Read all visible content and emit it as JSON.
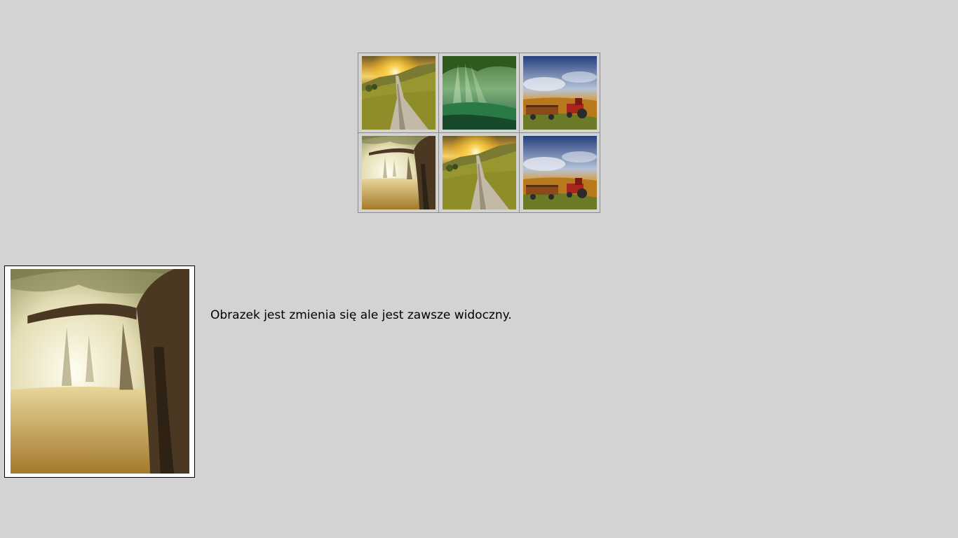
{
  "gallery": {
    "thumbnails": [
      {
        "icon": "sunset-road-icon"
      },
      {
        "icon": "forest-light-icon"
      },
      {
        "icon": "tractor-field-icon"
      },
      {
        "icon": "olive-grove-icon"
      },
      {
        "icon": "sunset-road-icon"
      },
      {
        "icon": "tractor-field-icon"
      }
    ]
  },
  "preview": {
    "icon": "olive-grove-icon",
    "caption": "Obrazek jest zmienia się ale jest zawsze widoczny."
  }
}
